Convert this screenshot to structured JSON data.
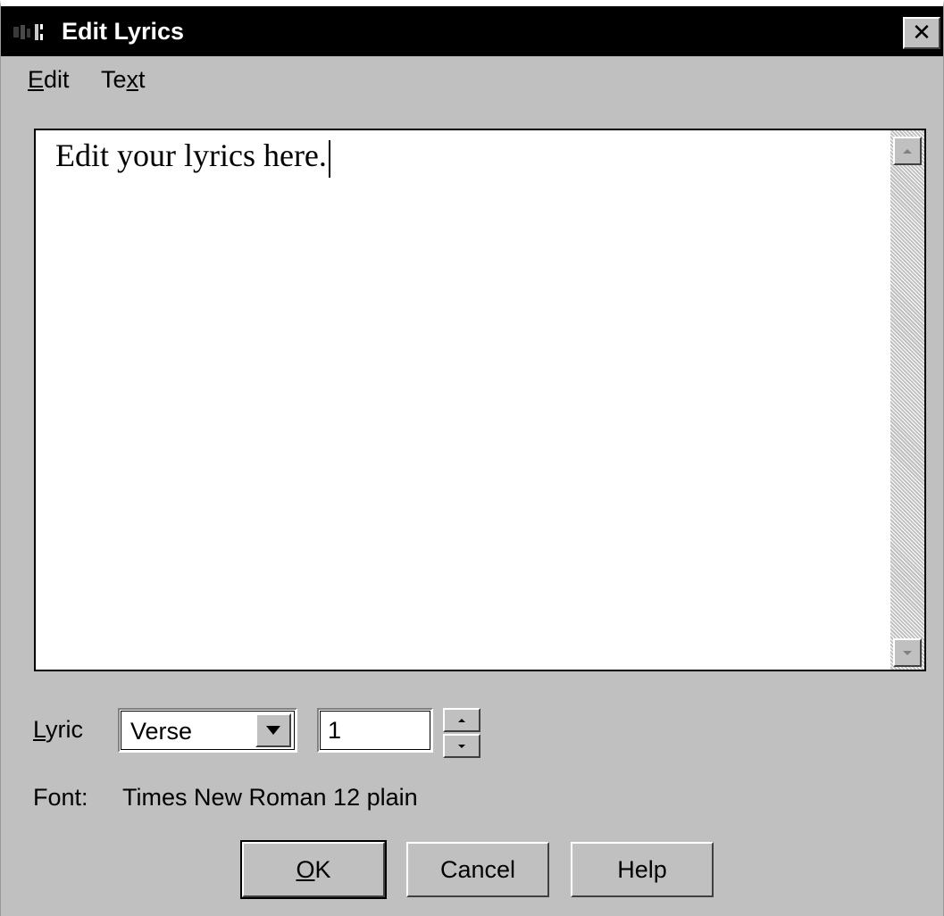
{
  "window": {
    "title": "Edit Lyrics",
    "app_icon": "lyrics-app-icon",
    "close_glyph": "✕"
  },
  "menu": {
    "items": [
      {
        "label": "Edit",
        "accelerator": "E"
      },
      {
        "label": "Text",
        "accelerator": "x"
      }
    ]
  },
  "editor": {
    "text": "Edit your lyrics here."
  },
  "lyric": {
    "label": "Lyric",
    "type_selected": "Verse",
    "number": "1"
  },
  "font": {
    "label": "Font:",
    "value": "Times New Roman 12 plain"
  },
  "buttons": {
    "ok": "OK",
    "cancel": "Cancel",
    "help": "Help"
  },
  "colors": {
    "titlebar": "#000000",
    "dialog_face": "#c0c0c0",
    "editor_background": "#ffffff"
  }
}
